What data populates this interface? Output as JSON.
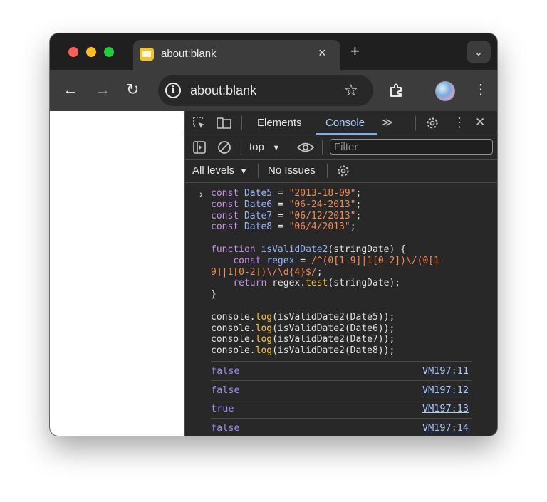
{
  "window": {
    "traffic_lights": {
      "close": "#ff5f57",
      "minimize": "#febc2e",
      "zoom": "#28c840"
    },
    "tab": {
      "title": "about:blank",
      "close_glyph": "×"
    },
    "new_tab_glyph": "+",
    "tab_search_glyph": "⌄"
  },
  "toolbar": {
    "back_glyph": "←",
    "forward_glyph": "→",
    "reload_glyph": "↻",
    "url": "about:blank",
    "star_glyph": "☆",
    "menu_glyph": "⋮"
  },
  "devtools": {
    "tabs": [
      {
        "label": "Elements",
        "active": false
      },
      {
        "label": "Console",
        "active": true
      }
    ],
    "more_tabs_glyph": "≫",
    "close_glyph": "✕",
    "context": "top",
    "filter_placeholder": "Filter",
    "levels": "All levels",
    "issues": "No Issues",
    "accent_color": "#7cacf8"
  },
  "console": {
    "code_lines": [
      [
        [
          "k",
          "const "
        ],
        [
          "v",
          "Date5"
        ],
        [
          "p",
          " = "
        ],
        [
          "s",
          "\"2013-18-09\""
        ],
        [
          "p",
          ";"
        ]
      ],
      [
        [
          "k",
          "const "
        ],
        [
          "v",
          "Date6"
        ],
        [
          "p",
          " = "
        ],
        [
          "s",
          "\"06-24-2013\""
        ],
        [
          "p",
          ";"
        ]
      ],
      [
        [
          "k",
          "const "
        ],
        [
          "v",
          "Date7"
        ],
        [
          "p",
          " = "
        ],
        [
          "s",
          "\"06/12/2013\""
        ],
        [
          "p",
          ";"
        ]
      ],
      [
        [
          "k",
          "const "
        ],
        [
          "v",
          "Date8"
        ],
        [
          "p",
          " = "
        ],
        [
          "s",
          "\"06/4/2013\""
        ],
        [
          "p",
          ";"
        ]
      ],
      [],
      [
        [
          "k",
          "function "
        ],
        [
          "v",
          "isValidDate2"
        ],
        [
          "p",
          "(stringDate) {"
        ]
      ],
      [
        [
          "p",
          "    "
        ],
        [
          "k",
          "const "
        ],
        [
          "v",
          "regex"
        ],
        [
          "p",
          " = "
        ],
        [
          "s",
          "/^(0[1-9]|1[0-2])\\/(0[1-"
        ]
      ],
      [
        [
          "s",
          "9]|1[0-2])\\/\\d{4}$/"
        ],
        [
          "p",
          ";"
        ]
      ],
      [
        [
          "p",
          "    "
        ],
        [
          "k",
          "return "
        ],
        [
          "p",
          "regex."
        ],
        [
          "m",
          "test"
        ],
        [
          "p",
          "(stringDate);"
        ]
      ],
      [
        [
          "p",
          "}"
        ]
      ],
      [],
      [
        [
          "p",
          "console."
        ],
        [
          "m",
          "log"
        ],
        [
          "p",
          "(isValidDate2(Date5));"
        ]
      ],
      [
        [
          "p",
          "console."
        ],
        [
          "m",
          "log"
        ],
        [
          "p",
          "(isValidDate2(Date6));"
        ]
      ],
      [
        [
          "p",
          "console."
        ],
        [
          "m",
          "log"
        ],
        [
          "p",
          "(isValidDate2(Date7));"
        ]
      ],
      [
        [
          "p",
          "console."
        ],
        [
          "m",
          "log"
        ],
        [
          "p",
          "(isValidDate2(Date8));"
        ]
      ]
    ],
    "outputs": [
      {
        "value": "false",
        "source": "VM197:11"
      },
      {
        "value": "false",
        "source": "VM197:12"
      },
      {
        "value": "true",
        "source": "VM197:13"
      },
      {
        "value": "false",
        "source": "VM197:14"
      }
    ]
  }
}
